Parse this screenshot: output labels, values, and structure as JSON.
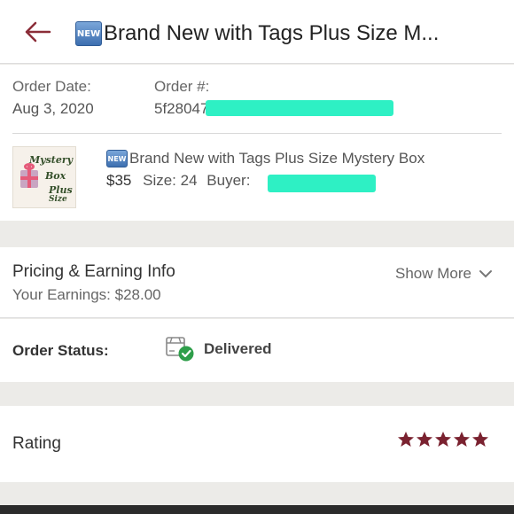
{
  "header": {
    "back_icon": "back-arrow-icon",
    "badge": "NEW",
    "title": "Brand New with Tags Plus Size M..."
  },
  "order": {
    "date_label": "Order Date:",
    "date_value": "Aug 3, 2020",
    "number_label": "Order #:",
    "number_value": "5f28047..."
  },
  "item": {
    "thumb_text": [
      "Mystery",
      "Box",
      "Plus",
      "Size"
    ],
    "badge": "NEW",
    "title": "Brand New with Tags Plus Size Mystery Box",
    "price": "$35",
    "size": "Size: 24",
    "buyer_label": "Buyer:"
  },
  "pricing": {
    "title": "Pricing & Earning Info",
    "earnings": "Your Earnings: $28.00",
    "show_more": "Show More"
  },
  "status": {
    "label": "Order Status:",
    "value": "Delivered"
  },
  "rating": {
    "label": "Rating",
    "stars": 5,
    "star_color": "#7a2230"
  },
  "colors": {
    "accent": "#8b2d38",
    "redaction": "#2ef0c4",
    "delivered_check": "#2e9e4a"
  }
}
